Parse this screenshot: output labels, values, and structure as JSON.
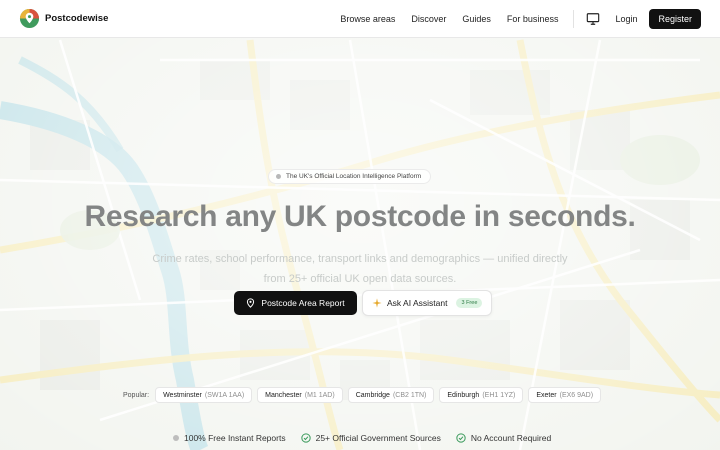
{
  "brand": {
    "name": "Postcodewise"
  },
  "nav": {
    "items": [
      {
        "label": "Browse areas"
      },
      {
        "label": "Discover"
      },
      {
        "label": "Guides"
      },
      {
        "label": "For business"
      }
    ],
    "login_label": "Login",
    "register_label": "Register"
  },
  "hero": {
    "badge": "The UK's Official Location Intelligence Platform",
    "title": "Research any UK postcode in seconds.",
    "subtitle": "Crime rates, school performance, transport links and demographics — unified directly from 25+ official UK open data sources.",
    "primary_button": "Postcode Area Report",
    "secondary_button": "Ask AI Assistant",
    "free_badge": "3 Free"
  },
  "popular": {
    "label": "Popular:",
    "items": [
      {
        "name": "Westminster",
        "code": "(SW1A 1AA)"
      },
      {
        "name": "Manchester",
        "code": "(M1 1AD)"
      },
      {
        "name": "Cambridge",
        "code": "(CB2 1TN)"
      },
      {
        "name": "Edinburgh",
        "code": "(EH1 1YZ)"
      },
      {
        "name": "Exeter",
        "code": "(EX6 9AD)"
      }
    ]
  },
  "features": [
    {
      "label": "100% Free Instant Reports",
      "icon": "dot-icon"
    },
    {
      "label": "25+ Official Government Sources",
      "icon": "check-circle-icon"
    },
    {
      "label": "No Account Required",
      "icon": "check-circle-icon"
    }
  ],
  "colors": {
    "accent": "#111111",
    "title_gray": "#838585",
    "free_green": "#2b7a43",
    "map_water": "#a9d7e0",
    "map_road": "#f4e7a6"
  }
}
